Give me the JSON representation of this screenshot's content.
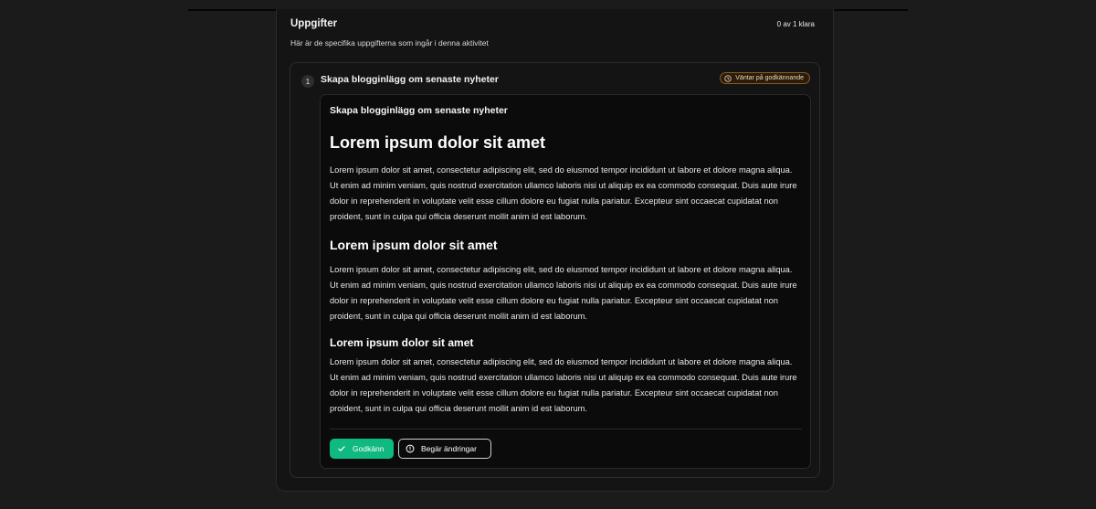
{
  "section": {
    "title": "Uppgifter",
    "count": "0 av 1 klara",
    "description": "Här är de specifika uppgifterna som ingår i denna aktivitet"
  },
  "task": {
    "number": "1",
    "title": "Skapa blogginlägg om senaste nyheter",
    "status": "Väntar på godkännande",
    "status_color": "#f59e0b",
    "content": {
      "title": "Skapa blogginlägg om senaste nyheter",
      "heading1": "Lorem ipsum dolor sit amet",
      "paragraph1": "Lorem ipsum dolor sit amet, consectetur adipiscing elit, sed do eiusmod tempor incididunt ut labore et dolore magna aliqua. Ut enim ad minim veniam, quis nostrud exercitation ullamco laboris nisi ut aliquip ex ea commodo consequat. Duis aute irure dolor in reprehenderit in voluptate velit esse cillum dolore eu fugiat nulla pariatur. Excepteur sint occaecat cupidatat non proident, sunt in culpa qui officia deserunt mollit anim id est laborum.",
      "heading2": "Lorem ipsum dolor sit amet",
      "paragraph2": "Lorem ipsum dolor sit amet, consectetur adipiscing elit, sed do eiusmod tempor incididunt ut labore et dolore magna aliqua. Ut enim ad minim veniam, quis nostrud exercitation ullamco laboris nisi ut aliquip ex ea commodo consequat. Duis aute irure dolor in reprehenderit in voluptate velit esse cillum dolore eu fugiat nulla pariatur. Excepteur sint occaecat cupidatat non proident, sunt in culpa qui officia deserunt mollit anim id est laborum.",
      "heading3": "Lorem ipsum dolor sit amet",
      "paragraph3": "Lorem ipsum dolor sit amet, consectetur adipiscing elit, sed do eiusmod tempor incididunt ut labore et dolore magna aliqua. Ut enim ad minim veniam, quis nostrud exercitation ullamco laboris nisi ut aliquip ex ea commodo consequat. Duis aute irure dolor in reprehenderit in voluptate velit esse cillum dolore eu fugiat nulla pariatur. Excepteur sint occaecat cupidatat non proident, sunt in culpa qui officia deserunt mollit anim id est laborum."
    },
    "actions": {
      "approve_label": "Godkänn",
      "approve_icon": "check-icon",
      "approve_color": "#10b981",
      "request_changes_label": "Begär ändringar",
      "request_changes_icon": "alert-circle-icon"
    }
  }
}
